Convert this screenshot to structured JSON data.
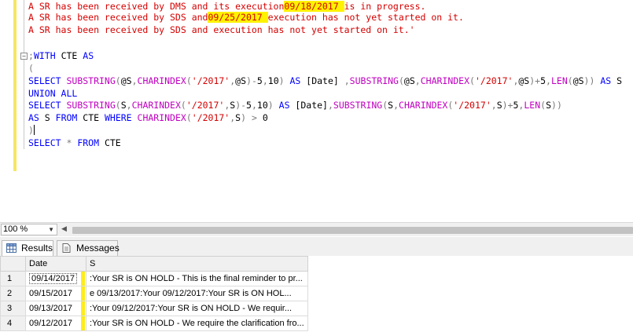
{
  "editor": {
    "lines": [
      {
        "segments": [
          {
            "text": "A SR has been received by DMS and its execution",
            "cls": "red"
          },
          {
            "text": "09/18/2017 ",
            "cls": "red hl"
          },
          {
            "text": "is in progress.",
            "cls": "red"
          }
        ]
      },
      {
        "segments": [
          {
            "text": "A SR has been received by SDS and",
            "cls": "red"
          },
          {
            "text": "09/25/2017 ",
            "cls": "red hl"
          },
          {
            "text": "execution has not yet started on it.",
            "cls": "red"
          }
        ]
      },
      {
        "segments": [
          {
            "text": "A SR has been received by SDS and execution has not yet started on it.'",
            "cls": "red"
          }
        ]
      },
      {
        "segments": []
      },
      {
        "segments": [
          {
            "text": ";",
            "cls": "gray"
          },
          {
            "text": "WITH",
            "cls": "blue"
          },
          {
            "text": " CTE ",
            "cls": "black"
          },
          {
            "text": "AS",
            "cls": "blue"
          }
        ]
      },
      {
        "segments": [
          {
            "text": "(",
            "cls": "gray"
          }
        ]
      },
      {
        "segments": [
          {
            "text": "SELECT ",
            "cls": "blue"
          },
          {
            "text": "SUBSTRING",
            "cls": "magenta"
          },
          {
            "text": "(",
            "cls": "gray"
          },
          {
            "text": "@S",
            "cls": "black"
          },
          {
            "text": ",",
            "cls": "gray"
          },
          {
            "text": "CHARINDEX",
            "cls": "magenta"
          },
          {
            "text": "(",
            "cls": "gray"
          },
          {
            "text": "'/2017'",
            "cls": "red"
          },
          {
            "text": ",",
            "cls": "gray"
          },
          {
            "text": "@S",
            "cls": "black"
          },
          {
            "text": ")-",
            "cls": "gray"
          },
          {
            "text": "5",
            "cls": "black"
          },
          {
            "text": ",",
            "cls": "gray"
          },
          {
            "text": "10",
            "cls": "black"
          },
          {
            "text": ") ",
            "cls": "gray"
          },
          {
            "text": "AS ",
            "cls": "blue"
          },
          {
            "text": "[Date] ",
            "cls": "black"
          },
          {
            "text": ",",
            "cls": "gray"
          },
          {
            "text": "SUBSTRING",
            "cls": "magenta"
          },
          {
            "text": "(",
            "cls": "gray"
          },
          {
            "text": "@S",
            "cls": "black"
          },
          {
            "text": ",",
            "cls": "gray"
          },
          {
            "text": "CHARINDEX",
            "cls": "magenta"
          },
          {
            "text": "(",
            "cls": "gray"
          },
          {
            "text": "'/2017'",
            "cls": "red"
          },
          {
            "text": ",",
            "cls": "gray"
          },
          {
            "text": "@S",
            "cls": "black"
          },
          {
            "text": ")+",
            "cls": "gray"
          },
          {
            "text": "5",
            "cls": "black"
          },
          {
            "text": ",",
            "cls": "gray"
          },
          {
            "text": "LEN",
            "cls": "magenta"
          },
          {
            "text": "(",
            "cls": "gray"
          },
          {
            "text": "@S",
            "cls": "black"
          },
          {
            "text": ")) ",
            "cls": "gray"
          },
          {
            "text": "AS ",
            "cls": "blue"
          },
          {
            "text": "S",
            "cls": "black"
          }
        ]
      },
      {
        "segments": [
          {
            "text": "UNION ALL",
            "cls": "blue"
          }
        ]
      },
      {
        "segments": [
          {
            "text": "SELECT ",
            "cls": "blue"
          },
          {
            "text": "SUBSTRING",
            "cls": "magenta"
          },
          {
            "text": "(",
            "cls": "gray"
          },
          {
            "text": "S",
            "cls": "black"
          },
          {
            "text": ",",
            "cls": "gray"
          },
          {
            "text": "CHARINDEX",
            "cls": "magenta"
          },
          {
            "text": "(",
            "cls": "gray"
          },
          {
            "text": "'/2017'",
            "cls": "red"
          },
          {
            "text": ",",
            "cls": "gray"
          },
          {
            "text": "S",
            "cls": "black"
          },
          {
            "text": ")-",
            "cls": "gray"
          },
          {
            "text": "5",
            "cls": "black"
          },
          {
            "text": ",",
            "cls": "gray"
          },
          {
            "text": "10",
            "cls": "black"
          },
          {
            "text": ") ",
            "cls": "gray"
          },
          {
            "text": "AS ",
            "cls": "blue"
          },
          {
            "text": "[Date]",
            "cls": "black"
          },
          {
            "text": ",",
            "cls": "gray"
          },
          {
            "text": "SUBSTRING",
            "cls": "magenta"
          },
          {
            "text": "(",
            "cls": "gray"
          },
          {
            "text": "S",
            "cls": "black"
          },
          {
            "text": ",",
            "cls": "gray"
          },
          {
            "text": "CHARINDEX",
            "cls": "magenta"
          },
          {
            "text": "(",
            "cls": "gray"
          },
          {
            "text": "'/2017'",
            "cls": "red"
          },
          {
            "text": ",",
            "cls": "gray"
          },
          {
            "text": "S",
            "cls": "black"
          },
          {
            "text": ")+",
            "cls": "gray"
          },
          {
            "text": "5",
            "cls": "black"
          },
          {
            "text": ",",
            "cls": "gray"
          },
          {
            "text": "LEN",
            "cls": "magenta"
          },
          {
            "text": "(",
            "cls": "gray"
          },
          {
            "text": "S",
            "cls": "black"
          },
          {
            "text": "))",
            "cls": "gray"
          }
        ]
      },
      {
        "segments": [
          {
            "text": "AS ",
            "cls": "blue"
          },
          {
            "text": "S ",
            "cls": "black"
          },
          {
            "text": "FROM ",
            "cls": "blue"
          },
          {
            "text": "CTE ",
            "cls": "black"
          },
          {
            "text": "WHERE ",
            "cls": "blue"
          },
          {
            "text": "CHARINDEX",
            "cls": "magenta"
          },
          {
            "text": "(",
            "cls": "gray"
          },
          {
            "text": "'/2017'",
            "cls": "red"
          },
          {
            "text": ",",
            "cls": "gray"
          },
          {
            "text": "S",
            "cls": "black"
          },
          {
            "text": ") > ",
            "cls": "gray"
          },
          {
            "text": "0",
            "cls": "black"
          }
        ]
      },
      {
        "segments": [
          {
            "text": ")",
            "cls": "gray"
          }
        ],
        "caret": true
      },
      {
        "segments": [
          {
            "text": "SELECT ",
            "cls": "blue"
          },
          {
            "text": "* ",
            "cls": "gray"
          },
          {
            "text": "FROM ",
            "cls": "blue"
          },
          {
            "text": "CTE",
            "cls": "black"
          }
        ]
      }
    ]
  },
  "zoom": {
    "value": "100 %"
  },
  "tabs": {
    "results": "Results",
    "messages": "Messages"
  },
  "grid": {
    "columns": [
      "",
      "Date",
      "S"
    ],
    "rows": [
      {
        "num": "1",
        "date": "09/14/2017",
        "s": ":Your SR is ON HOLD - This is the final reminder to pr..."
      },
      {
        "num": "2",
        "date": "09/15/2017",
        "s": "e 09/13/2017:Your   09/12/2017:Your SR is ON HOL..."
      },
      {
        "num": "3",
        "date": "09/13/2017",
        "s": ":Your   09/12/2017:Your SR is ON HOLD - We requir..."
      },
      {
        "num": "4",
        "date": "09/12/2017",
        "s": ":Your SR is ON HOLD - We require the clarification fro..."
      }
    ]
  },
  "colors": {
    "string_red": "#d40000",
    "keyword_blue": "#0000ff",
    "function_magenta": "#c000c0",
    "highlight_yellow": "#fff200"
  },
  "icons": {
    "results_tab": "grid-icon",
    "messages_tab": "document-icon",
    "zoom_dropdown": "chevron-down-icon",
    "scroll_left": "arrow-left-icon",
    "fold": "collapse-icon"
  }
}
